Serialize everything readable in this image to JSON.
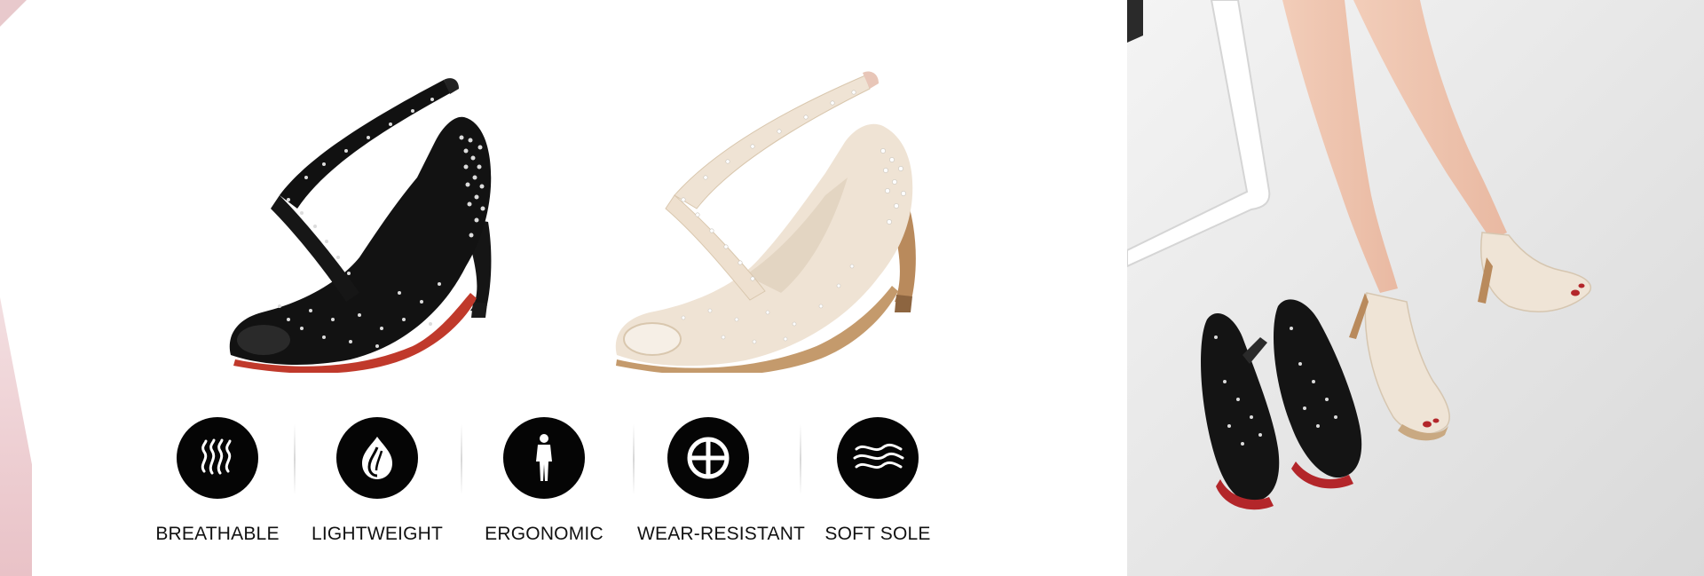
{
  "features": [
    {
      "label": "BREATHABLE",
      "icon": "waves-vertical-icon"
    },
    {
      "label": "LIGHTWEIGHT",
      "icon": "feather-drop-icon"
    },
    {
      "label": "ERGONOMIC",
      "icon": "human-figure-icon"
    },
    {
      "label": "WEAR-RESISTANT",
      "icon": "crosshair-circle-icon"
    },
    {
      "label": "SOFT SOLE",
      "icon": "waves-horizontal-icon"
    }
  ],
  "colors": {
    "icon_background": "#050505",
    "accent_pink": "#e8c9cc",
    "shoe_black": "#121212",
    "shoe_nude": "#efe3d4",
    "sole_red": "#c0392b"
  }
}
